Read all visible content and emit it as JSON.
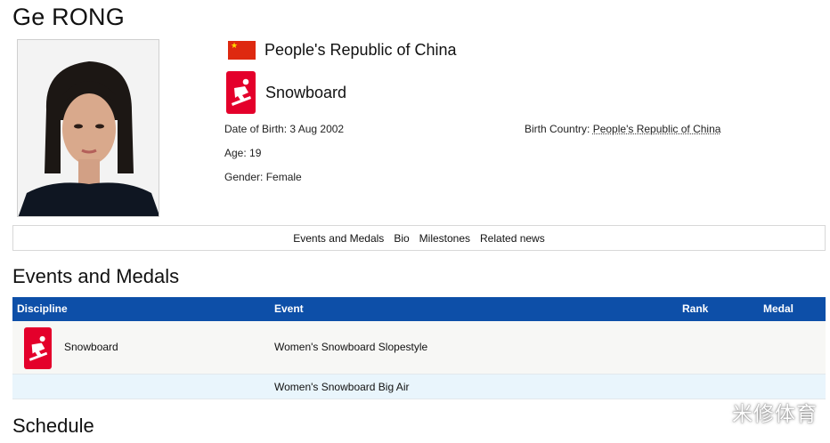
{
  "athlete": {
    "name": "Ge RONG"
  },
  "profile": {
    "country": "People's Republic of China",
    "sport": "Snowboard",
    "dob_label": "Date of Birth:",
    "dob_value": "3 Aug 2002",
    "age_label": "Age:",
    "age_value": "19",
    "gender_label": "Gender:",
    "gender_value": "Female",
    "birth_country_label": "Birth Country:",
    "birth_country_value": "People's Republic of China"
  },
  "subnav": [
    "Events and Medals",
    "Bio",
    "Milestones",
    "Related news"
  ],
  "sections": {
    "events_title": "Events and Medals",
    "schedule_title": "Schedule"
  },
  "table": {
    "headers": [
      "Discipline",
      "Event",
      "Rank",
      "Medal"
    ],
    "rows": [
      {
        "discipline": "Snowboard",
        "event": "Women's Snowboard Slopestyle",
        "rank": "",
        "medal": ""
      },
      {
        "discipline": "",
        "event": "Women's Snowboard Big Air",
        "rank": "",
        "medal": ""
      }
    ]
  },
  "watermark": "米修体育",
  "colors": {
    "header_blue": "#0d4fa8",
    "pictogram_red": "#e4002b",
    "flag_red": "#de2910"
  },
  "icons": {
    "flag": "china-flag-icon",
    "sport": "snowboard-pictogram-icon"
  }
}
